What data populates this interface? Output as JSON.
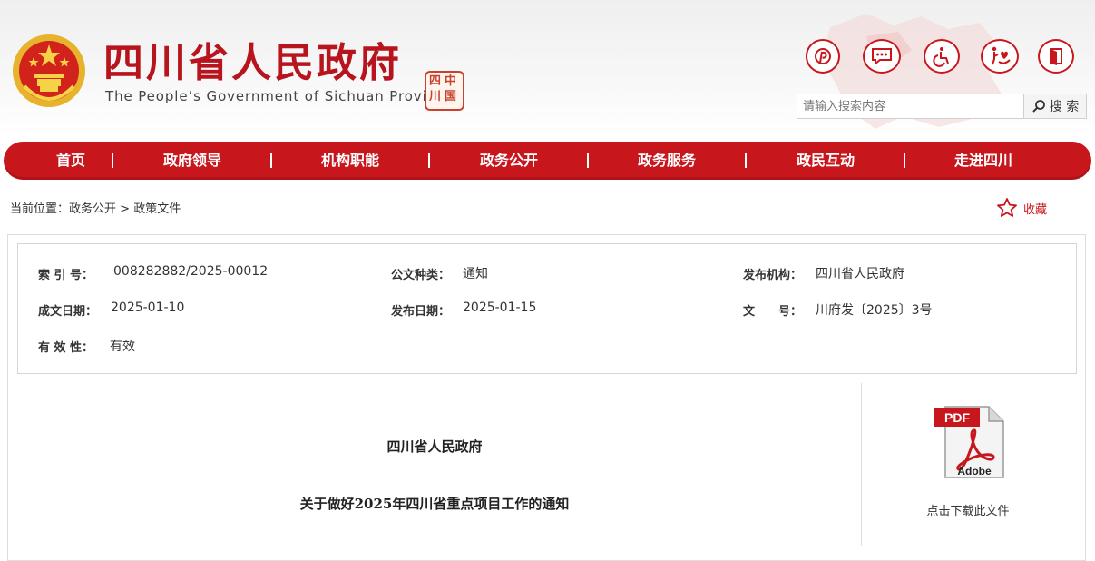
{
  "header": {
    "site_title": "四川省人民政府",
    "site_subtitle": "The People’s Government of Sichuan Province",
    "seal_chars": [
      "中",
      "国",
      "四",
      "川"
    ],
    "brand_color": "#c8161d",
    "tools": [
      {
        "name": "pinterest-style-icon",
        "label": ""
      },
      {
        "name": "message-icon",
        "label": ""
      },
      {
        "name": "accessibility-icon",
        "label": ""
      },
      {
        "name": "elder-care-icon",
        "label": ""
      },
      {
        "name": "exit-door-icon",
        "label": ""
      }
    ],
    "search": {
      "placeholder": "请输入搜索内容",
      "button_label": "搜 索"
    }
  },
  "nav": {
    "items": [
      "首页",
      "政府领导",
      "机构职能",
      "政务公开",
      "政务服务",
      "政民互动",
      "走进四川"
    ]
  },
  "breadcrumb": {
    "prefix": "当前位置：",
    "level1": "政务公开",
    "separator": ">",
    "level2": "政策文件"
  },
  "favorite": {
    "label": "收藏"
  },
  "meta": {
    "index_no_label": "索 引 号：",
    "index_no": "008282882/2025-00012",
    "doc_type_label": "公文种类：",
    "doc_type": "通知",
    "issuer_label": "发布机构：",
    "issuer": "四川省人民政府",
    "written_date_label": "成文日期：",
    "written_date": "2025-01-10",
    "publish_date_label": "发布日期：",
    "publish_date": "2025-01-15",
    "doc_no_label": "文　　号：",
    "doc_no": "川府发〔2025〕3号",
    "validity_label": "有 效 性：",
    "validity": "有效"
  },
  "document": {
    "issuer": "四川省人民政府",
    "title": "关于做好2025年四川省重点项目工作的通知"
  },
  "attachment": {
    "pdf_badge": "PDF",
    "adobe_label": "Adobe",
    "download_label": "点击下载此文件"
  }
}
